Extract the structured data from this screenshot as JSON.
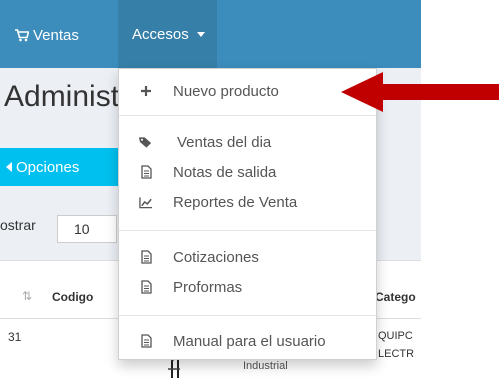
{
  "navbar": {
    "ventas_label": "Ventas",
    "accesos_label": "Accesos",
    "bg_color": "#3c8dbc"
  },
  "page": {
    "title": "Administ",
    "options_button": "Opciones",
    "mostrar_label": "ostrar",
    "mostrar_value": "10"
  },
  "table": {
    "headers": {
      "codigo": "Codigo",
      "categoria": "Catego"
    },
    "row": {
      "id": "31",
      "categoria_line1": "QUIPC",
      "categoria_line2": "LECTR",
      "desc_fragment": "Industrial"
    }
  },
  "dropdown": {
    "items": [
      {
        "label": "Nuevo producto",
        "icon": "plus-icon"
      },
      {
        "label": "Ventas del dia",
        "icon": "tags-icon"
      },
      {
        "label": "Notas de salida",
        "icon": "document-icon"
      },
      {
        "label": "Reportes de Venta",
        "icon": "line-chart-icon"
      },
      {
        "label": "Cotizaciones",
        "icon": "document-icon"
      },
      {
        "label": "Proformas",
        "icon": "document-icon"
      },
      {
        "label": "Manual para el usuario",
        "icon": "document-icon"
      }
    ]
  },
  "annotation": {
    "arrow_color": "#c00000"
  }
}
